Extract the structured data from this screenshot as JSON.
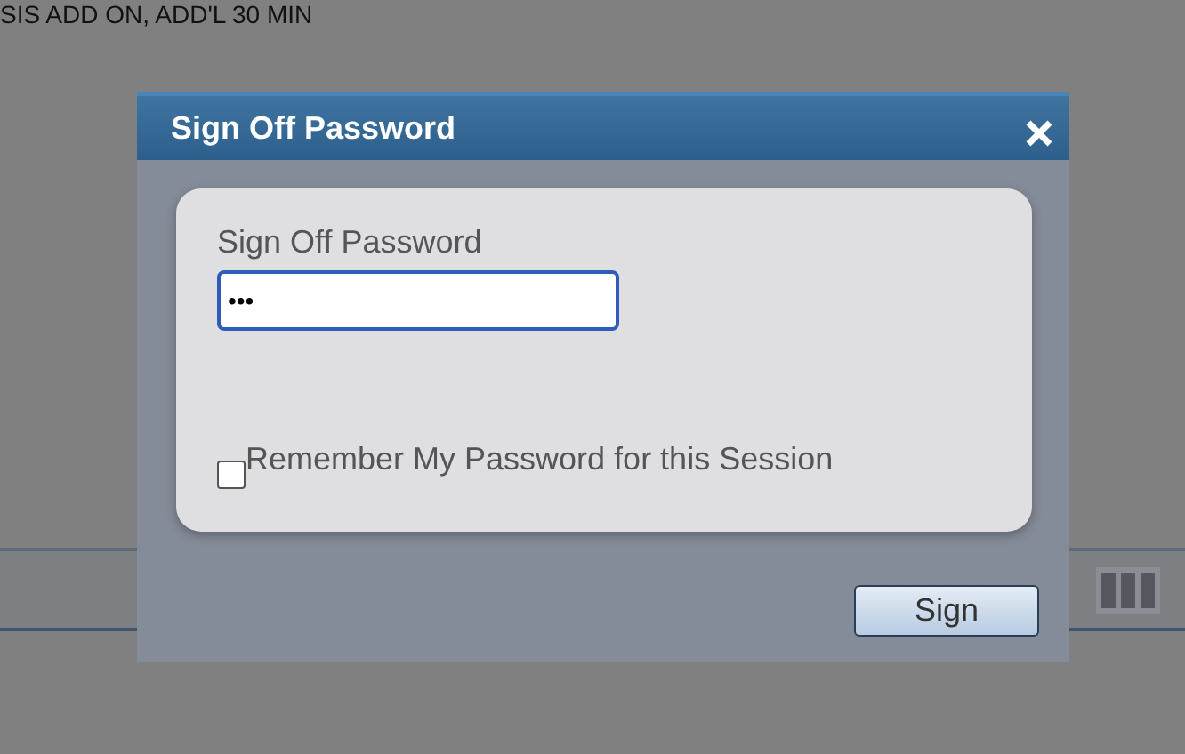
{
  "background_text": "SIS ADD ON, ADD'L 30 MIN",
  "dialog": {
    "title": "Sign Off Password",
    "field_label": "Sign Off Password",
    "password_value": "•••",
    "remember": {
      "label": "Remember My Password for this Session",
      "checked": false
    },
    "buttons": [
      "Sign"
    ]
  }
}
